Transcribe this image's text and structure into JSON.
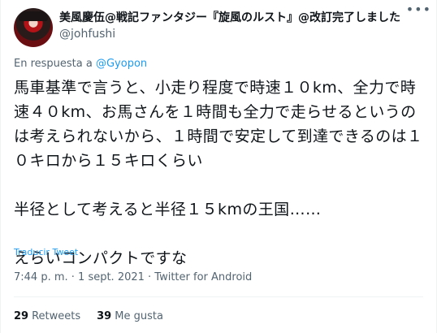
{
  "author": {
    "display_name": "美風慶伍@戦記ファンタジー『旋風のルスト』@改訂完了しました",
    "handle": "@johfushi",
    "avatar_icon": "avatar-photo"
  },
  "more_icon": "more-icon",
  "reply": {
    "prefix": "En respuesta a ",
    "mention": "@Gyopon"
  },
  "tweet_text": "馬車基準で言うと、小走り程度で時速１０km、全力で時速４０km、お馬さんを１時間も全力で走らせるというのは考えられないから、１時間で安定して到達できるのは１０キロから１５キロくらい\n\n半径として考えると半径１５kmの王国……\n\nえらいコンパクトですな",
  "translate_label": "Traducir Tweet",
  "timestamp": "7:44 p. m. · 1 sept. 2021 · Twitter for Android",
  "stats": {
    "retweets_count": "29",
    "retweets_label": "Retweets",
    "likes_count": "39",
    "likes_label": "Me gusta"
  },
  "colors": {
    "link": "#1d9bf0",
    "secondary": "#536471",
    "text": "#0f1419"
  }
}
